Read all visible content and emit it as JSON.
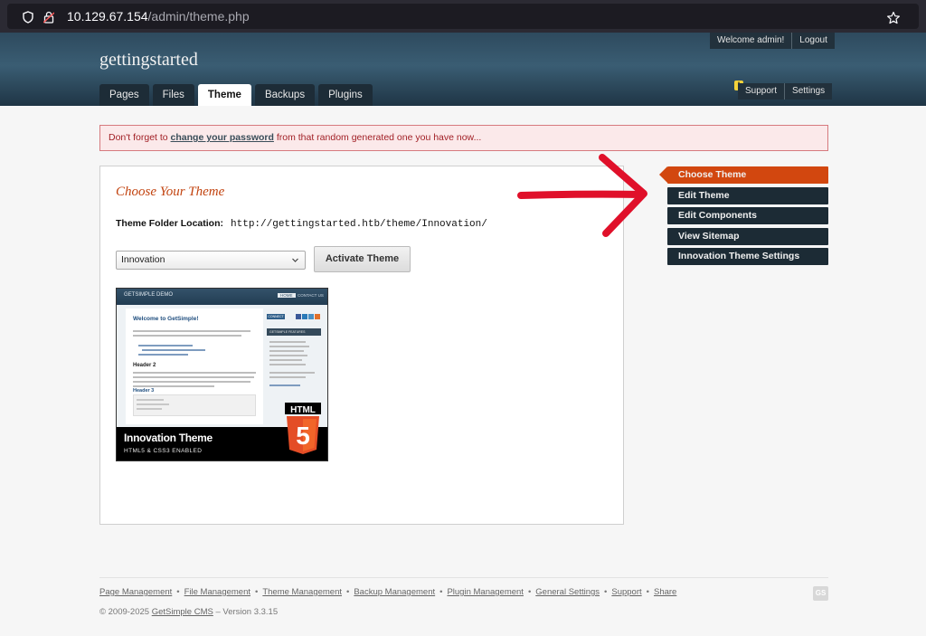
{
  "browser": {
    "url_host": "10.129.67.154",
    "url_path": "/admin/theme.php"
  },
  "header": {
    "site_name": "gettingstarted",
    "welcome": "Welcome admin!",
    "logout": "Logout",
    "tabs": [
      {
        "label": "Pages"
      },
      {
        "label": "Files"
      },
      {
        "label": "Theme"
      },
      {
        "label": "Backups"
      },
      {
        "label": "Plugins"
      }
    ],
    "warn_mark": "!",
    "support": "Support",
    "settings": "Settings"
  },
  "alert": {
    "before": "Don't forget to ",
    "link": "change your password",
    "after": " from that random generated one you have now..."
  },
  "panel": {
    "title": "Choose Your Theme",
    "folder_label": "Theme Folder Location:",
    "folder_path": "http://gettingstarted.htb/theme/Innovation/",
    "selected_theme": "Innovation",
    "activate_button": "Activate Theme",
    "thumbnail": {
      "brand": "GETSIMPLE DEMO",
      "nav_home": "HOME",
      "nav_contact": "CONTACT US",
      "welcome": "Welcome to GetSimple!",
      "header2": "Header 2",
      "header3": "Header 3",
      "connect": "CONNECT",
      "sidebar_heading": "GETSIMPLE FEATURES",
      "html_badge": "HTML",
      "html_version": "5",
      "theme_name": "Innovation Theme",
      "theme_sub": "HTML5 & CSS3 ENABLED"
    }
  },
  "sidebar": [
    {
      "label": "Choose Theme"
    },
    {
      "label": "Edit Theme"
    },
    {
      "label": "Edit Components"
    },
    {
      "label": "View Sitemap"
    },
    {
      "label": "Innovation Theme Settings"
    }
  ],
  "footer": {
    "links": [
      "Page Management",
      "File Management",
      "Theme Management",
      "Backup Management",
      "Plugin Management",
      "General Settings",
      "Support",
      "Share"
    ],
    "sep": "•",
    "copyright_before": "© 2009-2025 ",
    "copyright_link": "GetSimple CMS",
    "copyright_after": " – Version 3.3.15",
    "logo_text": "GS"
  },
  "colors": {
    "accent": "#d2470f",
    "sidebar_bg": "#1c2b35",
    "alert_border": "#d67a7e",
    "annotation_arrow": "#e0102a"
  }
}
